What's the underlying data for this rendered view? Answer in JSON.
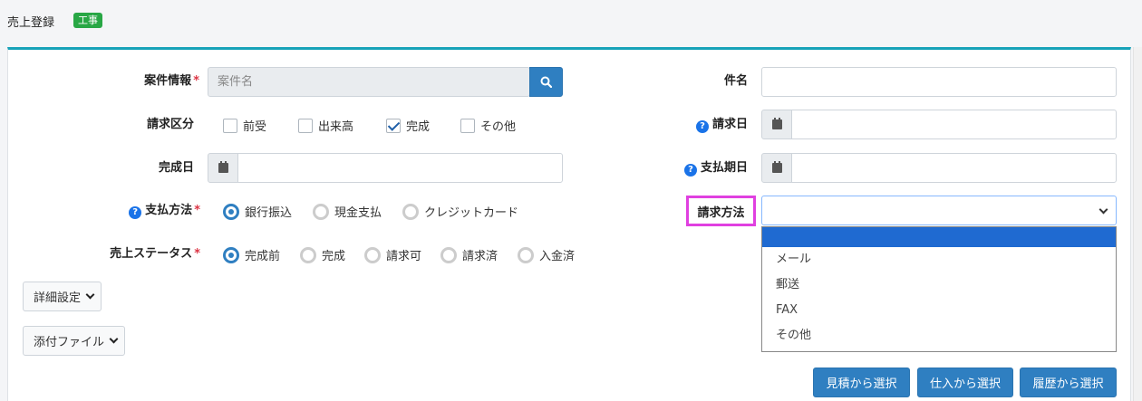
{
  "header": {
    "title": "売上登録",
    "badge": "工事",
    "badge_color": "#28a745"
  },
  "form": {
    "case_info": {
      "label": "案件情報",
      "required": "*",
      "placeholder": "案件名",
      "search_icon": "search-icon"
    },
    "billing_type": {
      "label": "請求区分",
      "options": [
        {
          "label": "前受",
          "checked": false
        },
        {
          "label": "出来高",
          "checked": false
        },
        {
          "label": "完成",
          "checked": true
        },
        {
          "label": "その他",
          "checked": false
        }
      ]
    },
    "completion_date": {
      "label": "完成日",
      "value": ""
    },
    "payment_method": {
      "label": "支払方法",
      "required": "*",
      "options": [
        {
          "label": "銀行振込",
          "selected": true
        },
        {
          "label": "現金支払",
          "selected": false
        },
        {
          "label": "クレジットカード",
          "selected": false
        }
      ]
    },
    "sales_status": {
      "label": "売上ステータス",
      "required": "*",
      "options": [
        {
          "label": "完成前",
          "selected": true
        },
        {
          "label": "完成",
          "selected": false
        },
        {
          "label": "請求可",
          "selected": false
        },
        {
          "label": "請求済",
          "selected": false
        },
        {
          "label": "入金済",
          "selected": false
        }
      ]
    },
    "subject": {
      "label": "件名",
      "value": ""
    },
    "billing_date": {
      "label": "請求日",
      "value": ""
    },
    "payment_due_date": {
      "label": "支払期日",
      "value": ""
    },
    "billing_method": {
      "label": "請求方法",
      "value": "",
      "options": [
        "",
        "メール",
        "郵送",
        "FAX",
        "その他"
      ]
    }
  },
  "buttons": {
    "details": "詳細設定",
    "attachments": "添付ファイル",
    "select_from_estimate": "見積から選択",
    "select_from_purchase": "仕入から選択",
    "select_from_history": "履歴から選択"
  },
  "colors": {
    "accent": "#2f7fc1",
    "panel_top_border": "#17a2b8",
    "highlight": "#e040e0",
    "required": "#dc3545"
  }
}
